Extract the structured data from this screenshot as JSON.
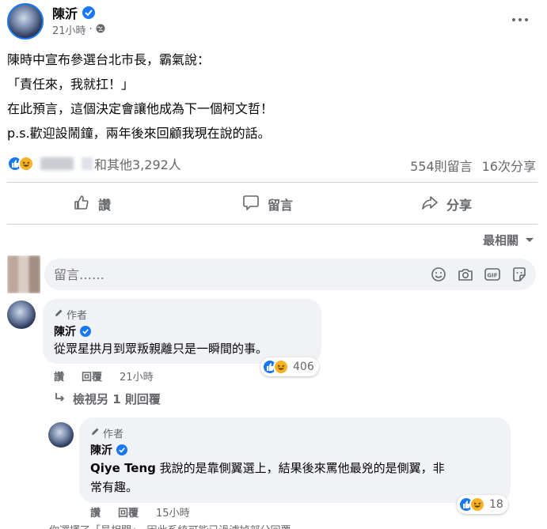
{
  "post": {
    "author_name": "陳沂",
    "time": "21小時",
    "separator": "·",
    "body_lines": [
      "陳時中宣布參選台北市長，霸氣說：",
      "「責任來，我就扛！」",
      "在此預言，這個決定會讓他成為下一個柯文哲！",
      "p.s.歡迎設鬧鐘，兩年後來回顧我現在說的話。"
    ],
    "reactions_text": "和其他3,292人",
    "comments_count": "554則留言",
    "shares_count": "16次分享"
  },
  "actions": {
    "like": "讚",
    "comment": "留言",
    "share": "分享"
  },
  "sort": {
    "label": "最相關"
  },
  "composer": {
    "placeholder": "留言……"
  },
  "comments": [
    {
      "tag": "作者",
      "author": "陳沂",
      "text": "從眾星拱月到眾叛親離只是一瞬間的事。",
      "reaction_count": "406",
      "like_label": "讚",
      "reply_label": "回覆",
      "time": "21小時",
      "view_replies": "檢視另 1 則回覆"
    },
    {
      "tag": "作者",
      "author": "陳沂",
      "mention": "Qiye Teng",
      "text_line1": " 我說的是靠側翼選上，結果後來罵他最兇的是側翼，非",
      "text_line2": "常有趣。",
      "reaction_count": "18",
      "like_label": "讚",
      "reply_label": "回覆",
      "time": "15小時"
    }
  ],
  "footer_note": "你選擇了「最相關」，因此系統可能已過濾掉部分回覆。",
  "colors": {
    "accent": "#1877f2",
    "muted": "#65676b",
    "bubble": "#f0f2f5",
    "haha": "#f7b125"
  }
}
